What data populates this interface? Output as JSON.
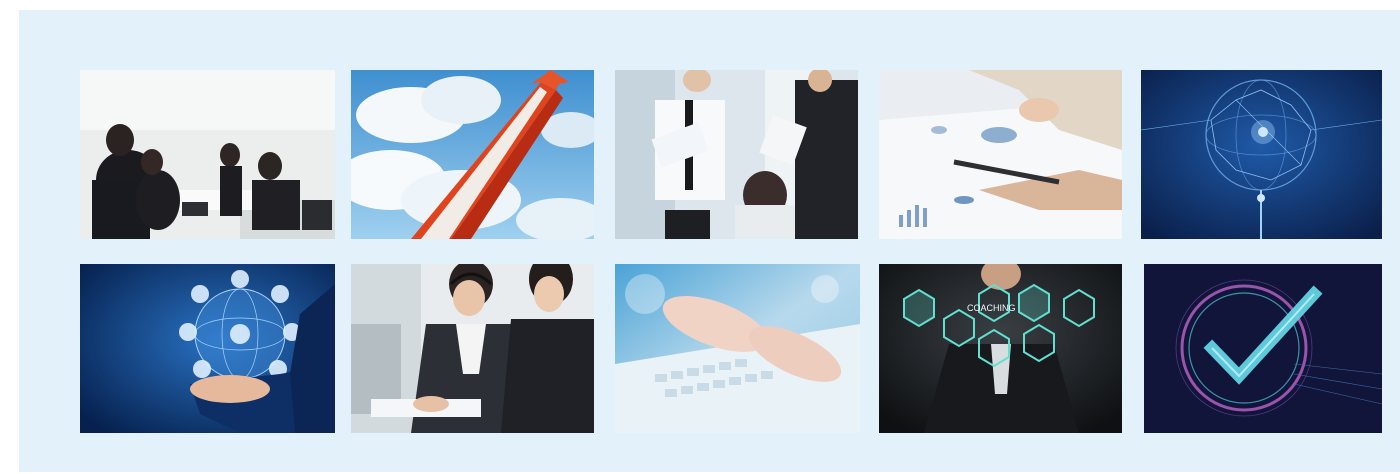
{
  "gallery": {
    "background": "#e3f2fa",
    "rows": [
      {
        "tiles": [
          {
            "icon": "business-meeting-photo"
          },
          {
            "icon": "stairway-to-sky-photo"
          },
          {
            "icon": "office-document-review-photo"
          },
          {
            "icon": "chart-analysis-pen-photo"
          },
          {
            "icon": "digital-globe-network-photo"
          }
        ]
      },
      {
        "tiles": [
          {
            "icon": "hand-holding-globe-icons-photo"
          },
          {
            "icon": "call-center-headset-photo"
          },
          {
            "icon": "typing-keyboard-photo"
          },
          {
            "icon": "coaching-hexagon-icons-photo"
          },
          {
            "icon": "checkmark-circle-photo"
          }
        ]
      }
    ],
    "overlay_text": {
      "coaching_label": "COACHING"
    }
  }
}
